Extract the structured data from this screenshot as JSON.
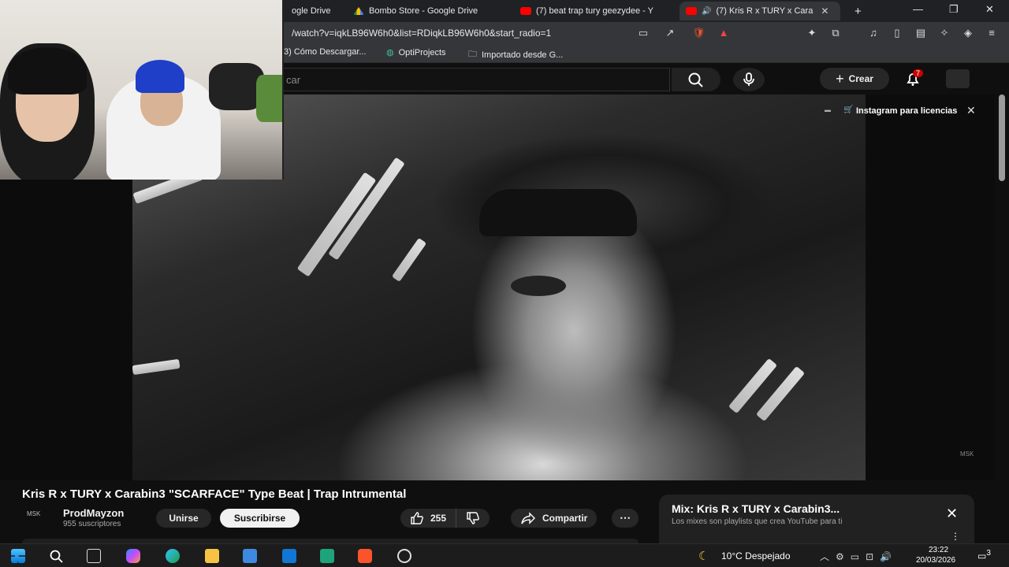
{
  "browser": {
    "tabs": [
      {
        "label": "ogle Drive",
        "icon": "google-drive-icon",
        "active": false
      },
      {
        "label": "Bombo Store - Google Drive",
        "icon": "google-drive-icon",
        "active": false
      },
      {
        "label": "(7) beat trap tury geezydee - Y",
        "icon": "youtube-icon",
        "active": false
      },
      {
        "label": "(7) Kris R x TURY x Cara",
        "icon": "youtube-icon",
        "active": true
      }
    ],
    "new_tab": "+",
    "url": "/watch?v=iqkLB96W6h0&list=RDiqkLB96W6h0&start_radio=1",
    "bookmarks": [
      "3) Cómo Descargar...",
      "OptiProjects",
      "Importado desde G..."
    ]
  },
  "youtube": {
    "search_placeholder": "car",
    "create_label": "Crear",
    "notification_count": "7"
  },
  "player": {
    "license_label": "Instagram para licencias",
    "watermark": "MSK"
  },
  "video": {
    "title": "Kris R x TURY x Carabin3 \"SCARFACE\" Type Beat | Trap Intrumental",
    "channel": "ProdMayzon",
    "subscribers": "955 suscriptores",
    "join_label": "Unirse",
    "subscribe_label": "Suscribirse",
    "likes": "255",
    "share_label": "Compartir",
    "channel_avatar_text": "MSK"
  },
  "mix": {
    "title": "Mix: Kris R x TURY x Carabin3...",
    "subtitle": "Los mixes son playlists que crea YouTube para ti"
  },
  "taskbar": {
    "weather": "10°C  Despejado",
    "time": "23:22",
    "date": "20/03/2026",
    "notifications": "3"
  }
}
